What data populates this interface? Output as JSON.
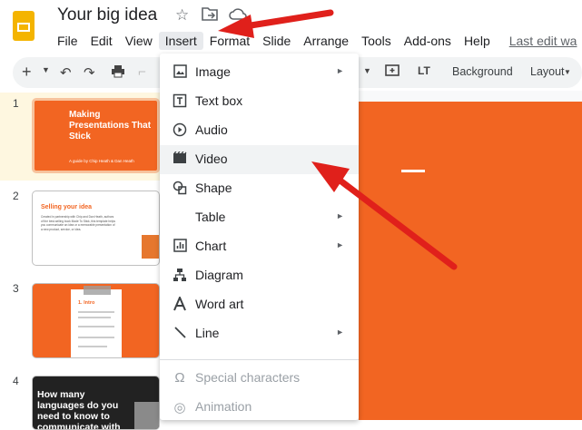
{
  "doc": {
    "title": "Your big idea",
    "last_edit": "Last edit wa"
  },
  "menubar": [
    "File",
    "Edit",
    "View",
    "Insert",
    "Format",
    "Slide",
    "Arrange",
    "Tools",
    "Add-ons",
    "Help"
  ],
  "toolbar": {
    "background_label": "Background",
    "layout_label": "Layout"
  },
  "slides": [
    {
      "number": "1",
      "title": "Making Presentations That Stick",
      "subtitle": "A guide by Chip Heath & Dan Heath"
    },
    {
      "number": "2",
      "title": "Selling your idea",
      "body": "Created in partnership with Chip and Dan Heath, authors of the best-selling book Made To Stick, this template helps you communicate an idea or a memorable presentation of a new product, service, or idea."
    },
    {
      "number": "3",
      "title": "1. Intro"
    },
    {
      "number": "4",
      "title": "How many languages do you need to know to communicate with"
    }
  ],
  "insert_menu": [
    {
      "label": "Image",
      "icon": "image-icon",
      "submenu": true
    },
    {
      "label": "Text box",
      "icon": "textbox-icon",
      "submenu": false
    },
    {
      "label": "Audio",
      "icon": "audio-icon",
      "submenu": false
    },
    {
      "label": "Video",
      "icon": "video-icon",
      "submenu": false,
      "hovered": true
    },
    {
      "label": "Shape",
      "icon": "shape-icon",
      "submenu": false
    },
    {
      "label": "Table",
      "icon": "",
      "submenu": true
    },
    {
      "label": "Chart",
      "icon": "chart-icon",
      "submenu": true
    },
    {
      "label": "Diagram",
      "icon": "diagram-icon",
      "submenu": false
    },
    {
      "label": "Word art",
      "icon": "wordart-icon",
      "submenu": false
    },
    {
      "label": "Line",
      "icon": "line-icon",
      "submenu": true
    },
    {
      "label": "Special characters",
      "icon": "omega-icon",
      "disabled": true
    },
    {
      "label": "Animation",
      "icon": "animation-icon",
      "disabled": true
    }
  ],
  "colors": {
    "slide_orange": "#f26522",
    "annotation_red": "#e0201b",
    "logo_yellow": "#f4b400"
  }
}
